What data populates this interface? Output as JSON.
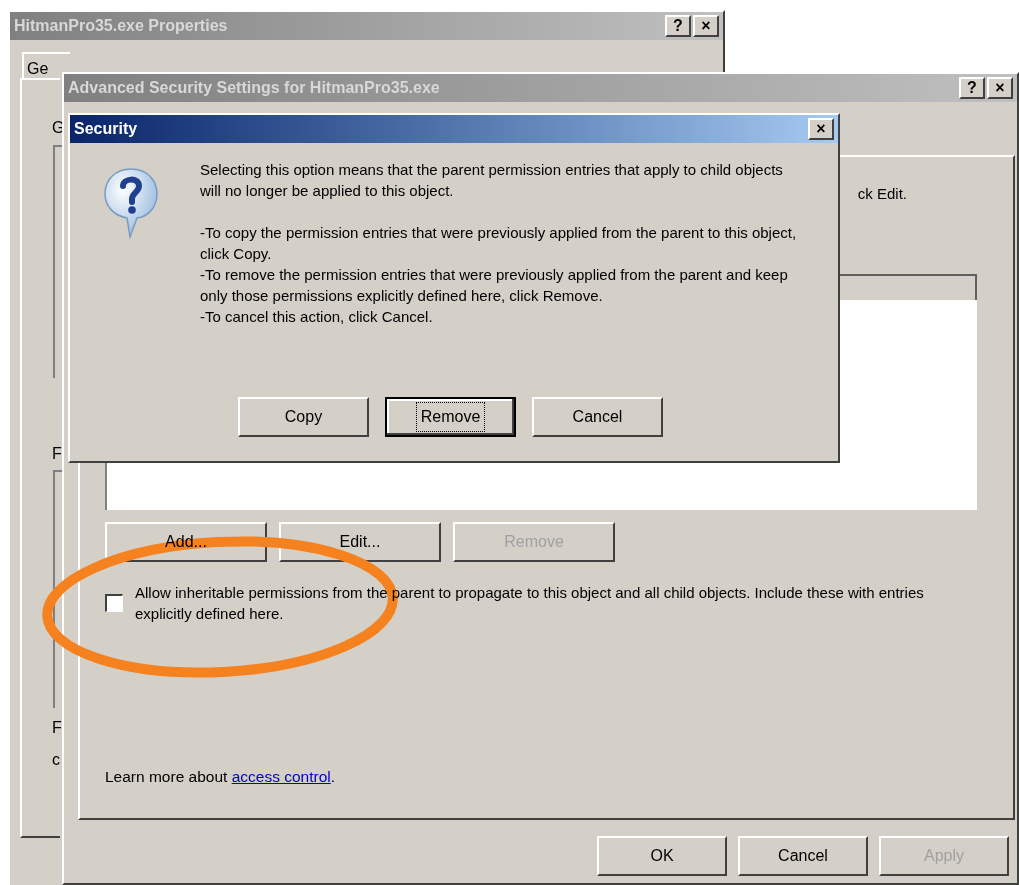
{
  "properties_window": {
    "title": "HitmanPro35.exe Properties",
    "active": false,
    "title_buttons": [
      "?",
      "×"
    ],
    "tab": "Ge",
    "fragments": [
      "G",
      "F",
      "F",
      "c"
    ]
  },
  "advanced_window": {
    "title": "Advanced Security Settings for HitmanPro35.exe",
    "active": false,
    "title_buttons": [
      "?",
      "×"
    ],
    "instruction_fragment": "ck Edit.",
    "buttons": [
      {
        "label": "Add...",
        "disabled": false
      },
      {
        "label": "Edit...",
        "disabled": false
      },
      {
        "label": "Remove",
        "disabled": true
      }
    ],
    "inherit_checkbox": {
      "label": "Allow inheritable permissions from the parent to propagate to this object and all child objects. Include these with entries explicitly defined here.",
      "checked": false
    },
    "learn_more": {
      "text": "Learn more about",
      "link": "access control",
      "after": "."
    },
    "footer_buttons": [
      {
        "label": "OK",
        "disabled": false
      },
      {
        "label": "Cancel",
        "disabled": false
      },
      {
        "label": "Apply",
        "disabled": true
      }
    ]
  },
  "security_dialog": {
    "title": "Security",
    "active": true,
    "close": "×",
    "paragraphs": [
      "Selecting this option means that the parent permission entries that apply to child objects will no longer be applied to this object.",
      "-To copy  the permission entries that were previously applied from the parent to this object, click Copy.",
      "-To remove the permission entries that were previously applied from the parent and keep only those permissions explicitly defined here, click Remove.",
      "-To cancel this action, click Cancel."
    ],
    "buttons": [
      {
        "label": "Copy",
        "focused": false
      },
      {
        "label": "Remove",
        "focused": true
      },
      {
        "label": "Cancel",
        "focused": false
      }
    ]
  }
}
